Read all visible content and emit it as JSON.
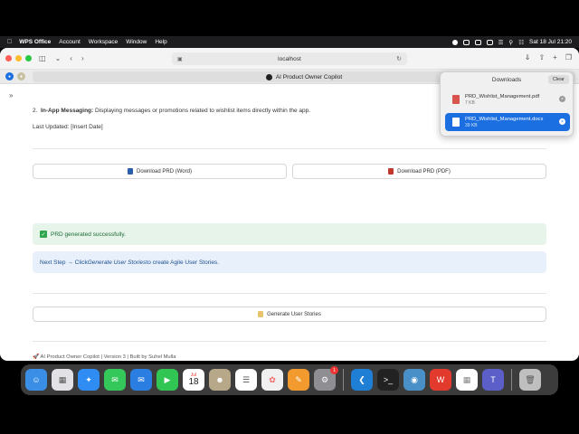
{
  "menubar": {
    "app_name": "WPS Office",
    "menus": [
      "Account",
      "Workspace",
      "Window",
      "Help"
    ],
    "datetime": "Sat 18 Jul  21:20"
  },
  "browser": {
    "address": "localhost",
    "tab_title": "AI Product Owner Copilot"
  },
  "page": {
    "list_item_number": "2.",
    "list_item_bold": "In-App Messaging:",
    "list_item_text": " Displaying messages or promotions related to wishlist items directly within the app.",
    "last_updated": "Last Updated: [Insert Date]",
    "download_word_label": "Download PRD (Word)",
    "download_pdf_label": "Download PRD (PDF)",
    "success_message": "PRD generated successfully.",
    "next_step_prefix": "Next Step → Click ",
    "next_step_emph": "Generate User Stories",
    "next_step_suffix": " to create Agile User Stories.",
    "generate_stories_label": "Generate User Stories",
    "footer": "🚀 AI Product Owner Copilot | Version 3 | Built by Suhel Mulla"
  },
  "downloads": {
    "title": "Downloads",
    "clear_label": "Clear",
    "items": [
      {
        "name": "PRD_Wishlist_Management.pdf",
        "size": "7 KB"
      },
      {
        "name": "PRD_Wishlist_Management.docx",
        "size": "39 KB"
      }
    ]
  },
  "dock": {
    "calendar_month": "Jul",
    "calendar_day": "18",
    "settings_badge": "1"
  },
  "colors": {
    "accent_blue": "#1b6fe0",
    "success_bg": "#e6f4ea",
    "info_bg": "#e8f0fc"
  }
}
